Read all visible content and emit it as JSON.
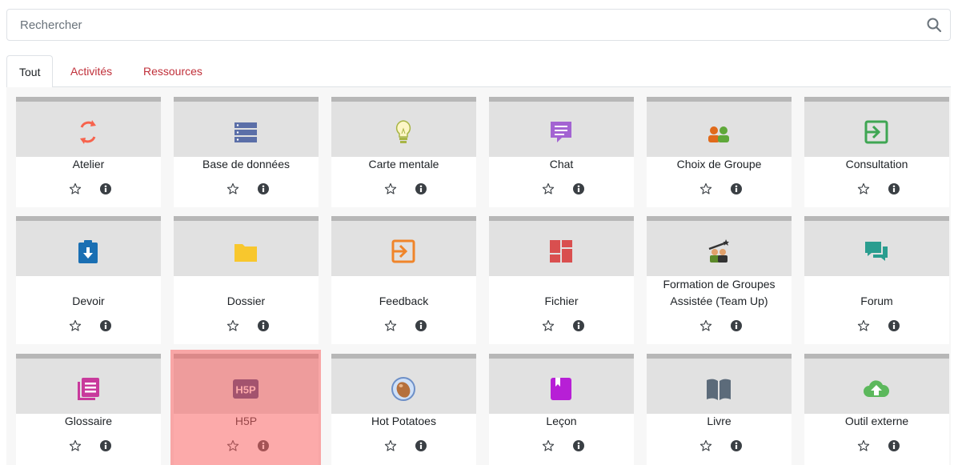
{
  "search": {
    "placeholder": "Rechercher",
    "value": ""
  },
  "tabs": [
    {
      "label": "Tout",
      "active": true
    },
    {
      "label": "Activités",
      "active": false
    },
    {
      "label": "Ressources",
      "active": false
    }
  ],
  "modules": [
    {
      "id": "atelier",
      "label": "Atelier",
      "icon": "workshop-icon",
      "color": "#f7634d"
    },
    {
      "id": "base-de-donnees",
      "label": "Base de données",
      "icon": "database-icon",
      "color": "#5b6fa8"
    },
    {
      "id": "carte-mentale",
      "label": "Carte mentale",
      "icon": "lightbulb-icon",
      "color": "#a8b545"
    },
    {
      "id": "chat",
      "label": "Chat",
      "icon": "chat-icon",
      "color": "#a363d2"
    },
    {
      "id": "choix-de-groupe",
      "label": "Choix de Groupe",
      "icon": "group-choice-icon",
      "color": "#e06a1b"
    },
    {
      "id": "consultation",
      "label": "Consultation",
      "icon": "consultation-icon",
      "color": "#3fa653"
    },
    {
      "id": "devoir",
      "label": "Devoir",
      "icon": "assignment-icon",
      "color": "#1a6fb3"
    },
    {
      "id": "dossier",
      "label": "Dossier",
      "icon": "folder-icon",
      "color": "#f8c72d"
    },
    {
      "id": "feedback",
      "label": "Feedback",
      "icon": "feedback-icon",
      "color": "#f0852a"
    },
    {
      "id": "fichier",
      "label": "Fichier",
      "icon": "file-icon",
      "color": "#d94f4f"
    },
    {
      "id": "formation-de-groupes",
      "label": "Formation de Groupes Assistée (Team Up)",
      "icon": "team-up-icon",
      "color": "#5c8a2a"
    },
    {
      "id": "forum",
      "label": "Forum",
      "icon": "forum-icon",
      "color": "#2a9d8f"
    },
    {
      "id": "glossaire",
      "label": "Glossaire",
      "icon": "glossary-icon",
      "color": "#c83a9c"
    },
    {
      "id": "h5p",
      "label": "H5P",
      "icon": "h5p-icon",
      "color": "#3b3f7a",
      "highlighted": true
    },
    {
      "id": "hot-potatoes",
      "label": "Hot Potatoes",
      "icon": "hot-potatoes-icon",
      "color": "#b5703d"
    },
    {
      "id": "lecon",
      "label": "Leçon",
      "icon": "lesson-icon",
      "color": "#b71fd6"
    },
    {
      "id": "livre",
      "label": "Livre",
      "icon": "book-icon",
      "color": "#5c6b7a"
    },
    {
      "id": "outil-externe",
      "label": "Outil externe",
      "icon": "external-tool-icon",
      "color": "#5cb85c"
    }
  ]
}
